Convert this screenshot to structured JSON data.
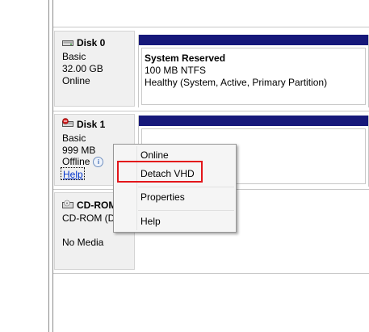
{
  "disks": [
    {
      "name": "Disk 0",
      "type": "Basic",
      "size": "32.00 GB",
      "status": "Online",
      "partition": {
        "name": "System Reserved",
        "size_fs": "100 MB NTFS",
        "health": "Healthy (System, Active, Primary Partition)"
      }
    },
    {
      "name": "Disk 1",
      "type": "Basic",
      "size": "999 MB",
      "status": "Offline",
      "help": "Help"
    },
    {
      "name": "CD-ROM",
      "type": "CD-ROM (D",
      "media": "No Media"
    }
  ],
  "context_menu": {
    "items": [
      "Online",
      "Detach VHD",
      "Properties",
      "Help"
    ],
    "highlighted": "Detach VHD"
  },
  "colors": {
    "partition_bar": "#16187a",
    "highlight_box": "#e3161b"
  }
}
